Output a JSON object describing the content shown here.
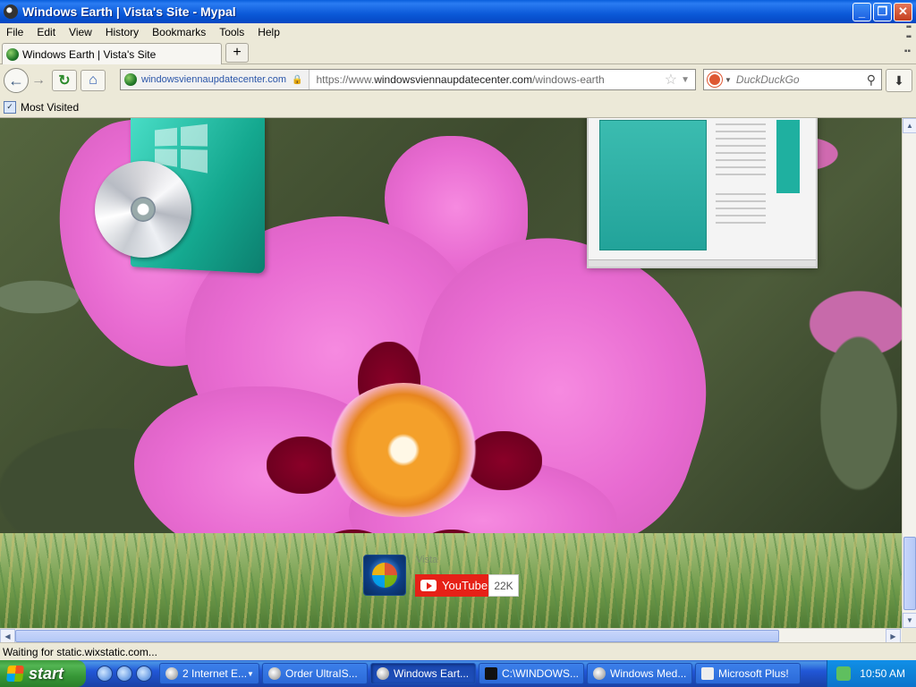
{
  "window": {
    "title": "Windows Earth | Vista's Site - Mypal"
  },
  "menu": [
    "File",
    "Edit",
    "View",
    "History",
    "Bookmarks",
    "Tools",
    "Help"
  ],
  "tab": {
    "title": "Windows Earth | Vista's Site",
    "new_tab": "+"
  },
  "nav": {
    "site_identity": "windowsviennaupdatecenter.com",
    "url_prefix": "https://www.",
    "url_domain": "windowsviennaupdatecenter.com",
    "url_path": "/windows-earth",
    "search_placeholder": "DuckDuckGo"
  },
  "bookmarks": {
    "most_visited": "Most Visited"
  },
  "page": {
    "channel_name": "Vista",
    "youtube_label": "YouTube",
    "subscriber_count": "22K"
  },
  "status": {
    "text": "Waiting for static.wixstatic.com..."
  },
  "taskbar": {
    "start": "start",
    "tasks": [
      {
        "label": "2 Internet E...",
        "active": false
      },
      {
        "label": "Order UltraIS...",
        "active": false
      },
      {
        "label": "Windows Eart...",
        "active": true
      },
      {
        "label": "C:\\WINDOWS...",
        "active": false
      },
      {
        "label": "Windows Med...",
        "active": false
      },
      {
        "label": "Microsoft Plus!",
        "active": false
      }
    ],
    "clock": "10:50 AM"
  },
  "colors": {
    "titlebar": "#0b59d8",
    "youtube": "#e62117",
    "taskbar": "#2157d7",
    "start": "#379737"
  }
}
